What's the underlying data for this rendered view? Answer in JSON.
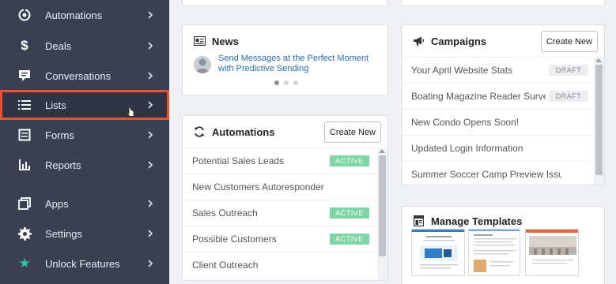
{
  "sidebar": {
    "items": [
      {
        "label": "Automations",
        "icon": "automations-icon"
      },
      {
        "label": "Deals",
        "icon": "dollar-icon"
      },
      {
        "label": "Conversations",
        "icon": "chat-icon"
      },
      {
        "label": "Lists",
        "icon": "list-icon",
        "selected": true
      },
      {
        "label": "Forms",
        "icon": "form-icon"
      },
      {
        "label": "Reports",
        "icon": "bar-chart-icon"
      },
      {
        "label": "Apps",
        "icon": "apps-icon"
      },
      {
        "label": "Settings",
        "icon": "gear-icon"
      },
      {
        "label": "Unlock Features",
        "icon": "star-icon"
      }
    ]
  },
  "news": {
    "title": "News",
    "link_text": "Send Messages at the Perfect Moment with Predictive Sending"
  },
  "automations": {
    "title": "Automations",
    "create_label": "Create New",
    "rows": [
      {
        "name": "Potential Sales Leads",
        "status": "ACTIVE"
      },
      {
        "name": "New Customers Autoresponder",
        "status": ""
      },
      {
        "name": "Sales Outreach",
        "status": "ACTIVE"
      },
      {
        "name": "Possible Customers",
        "status": "ACTIVE"
      },
      {
        "name": "Client Outreach",
        "status": ""
      }
    ]
  },
  "campaigns": {
    "title": "Campaigns",
    "create_label": "Create New",
    "rows": [
      {
        "name": "Your April Website Stats",
        "status": "DRAFT"
      },
      {
        "name": "Boating Magazine Reader Survey",
        "status": "DRAFT"
      },
      {
        "name": "New Condo Opens Soon!",
        "status": ""
      },
      {
        "name": "Updated Login Information",
        "status": ""
      },
      {
        "name": "Summer Soccer Camp Preview Issue",
        "status": ""
      }
    ]
  },
  "templates": {
    "title": "Manage Templates"
  },
  "colors": {
    "sidebar_bg": "#3a4052",
    "highlight_border": "#f0512c",
    "active_badge": "#7ed6a6",
    "link": "#2b6cb0",
    "star": "#2ec4a0"
  }
}
